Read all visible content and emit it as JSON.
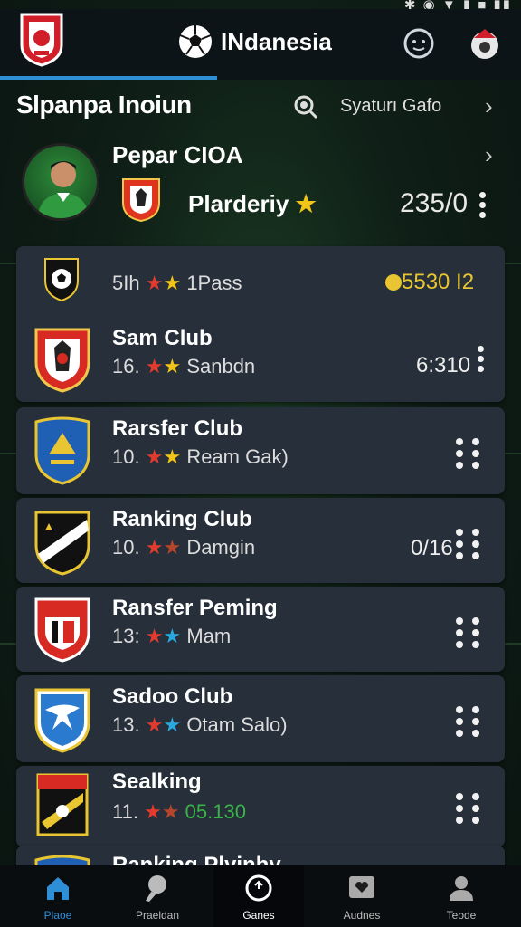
{
  "app": {
    "title": "INdanesia",
    "logo_icon": "club-crest-logo",
    "accent_color": "#2e8fd6"
  },
  "section": {
    "title": "Slpanpa Inoiun",
    "action_label": "Syaturı Gafo"
  },
  "player": {
    "name": "Pepar CIOA",
    "club": "Plarderiy",
    "value": "235/0"
  },
  "clubs": [
    {
      "name": "",
      "sub_prefix": "5Ih",
      "sub_text": "1Pass",
      "value": "5530 I2",
      "star1": "red",
      "star2": "gold",
      "badge": "soccer-ball-badge"
    },
    {
      "name": "Sam Club",
      "sub_prefix": "16.",
      "sub_text": "Sanbdn",
      "value": "6:310",
      "star1": "red",
      "star2": "gold",
      "badge": "red-shield-badge"
    },
    {
      "name": "Rarsfer Club",
      "sub_prefix": "10.",
      "sub_text": "Ream Gak)",
      "value": "",
      "star1": "red",
      "star2": "gold",
      "badge": "blue-shield-badge"
    },
    {
      "name": "Ranking Club",
      "sub_prefix": "10.",
      "sub_text": "Damgin",
      "value": "0/16",
      "star1": "red",
      "star2": "brown",
      "badge": "black-shield-badge"
    },
    {
      "name": "Ransfer Peming",
      "sub_prefix": "13:",
      "sub_text": "Mam",
      "value": "",
      "star1": "red",
      "star2": "blue",
      "badge": "red-white-badge"
    },
    {
      "name": "Sadoo Club",
      "sub_prefix": "13.",
      "sub_text": "Otam Salo)",
      "value": "",
      "star1": "red",
      "star2": "blue",
      "badge": "blue-bird-badge"
    },
    {
      "name": "Sealking",
      "sub_prefix": "11.",
      "sub_text": "05.130",
      "value": "",
      "star1": "red",
      "star2": "brown",
      "badge": "gold-black-badge"
    },
    {
      "name": "Ranking Plyinhy",
      "sub_prefix": "",
      "sub_text": "",
      "value": "",
      "star1": "",
      "star2": "",
      "badge": "blue-shield-badge"
    }
  ],
  "nav": [
    {
      "label": "Plaoe",
      "icon": "home-icon"
    },
    {
      "label": "Praeldan",
      "icon": "whistle-icon"
    },
    {
      "label": "Ganes",
      "icon": "target-icon"
    },
    {
      "label": "Audnes",
      "icon": "heart-box-icon"
    },
    {
      "label": "Teode",
      "icon": "person-icon"
    }
  ]
}
